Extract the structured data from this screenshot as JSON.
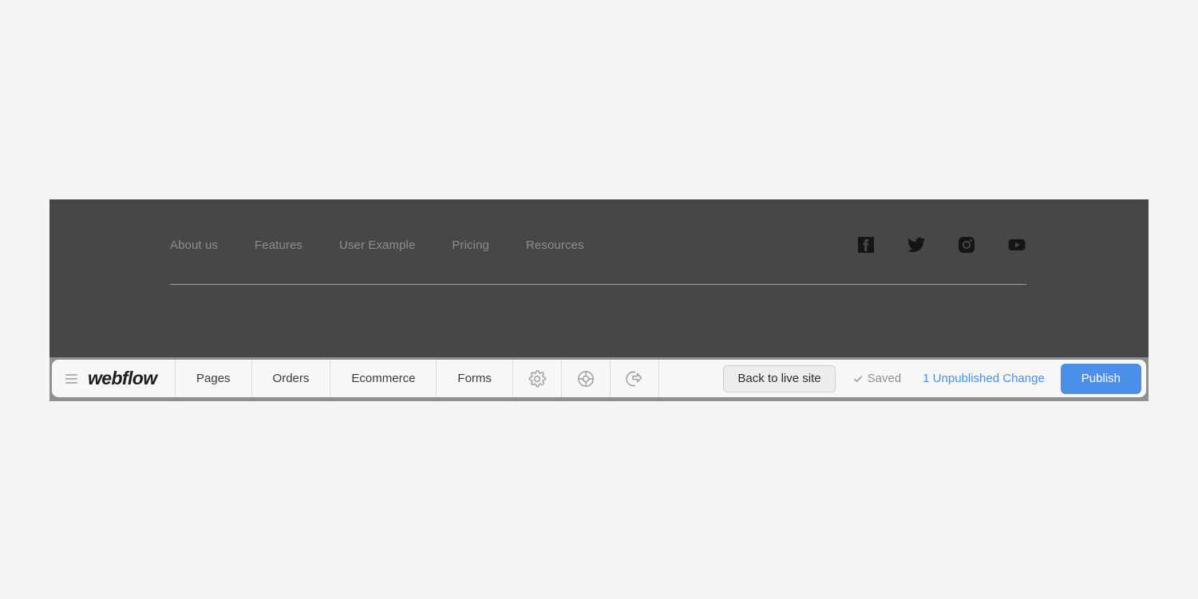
{
  "site_footer": {
    "nav_links": [
      {
        "label": "About us"
      },
      {
        "label": "Features"
      },
      {
        "label": "User Example"
      },
      {
        "label": "Pricing"
      },
      {
        "label": "Resources"
      }
    ],
    "social": [
      {
        "name": "facebook-icon"
      },
      {
        "name": "twitter-icon"
      },
      {
        "name": "instagram-icon"
      },
      {
        "name": "youtube-icon"
      }
    ],
    "background_color": "#474747",
    "link_color": "#8d8d8d",
    "divider_color": "#a0a0a0"
  },
  "toolbar": {
    "menu_icon": "hamburger-icon",
    "brand": "webflow",
    "tabs": [
      {
        "label": "Pages"
      },
      {
        "label": "Orders"
      },
      {
        "label": "Ecommerce"
      },
      {
        "label": "Forms"
      }
    ],
    "icon_buttons": [
      {
        "name": "settings-gear-icon"
      },
      {
        "name": "lifebuoy-help-icon"
      },
      {
        "name": "export-share-icon"
      }
    ],
    "back_to_live_site_label": "Back to live site",
    "saved_label": "Saved",
    "unpublished_changes_label": "1 Unpublished Change",
    "publish_label": "Publish",
    "accent_color": "#4a90e8",
    "link_color": "#4a8df0",
    "muted_text_color": "#8f8f8f",
    "background_color": "#f7f7f7",
    "frame_color": "#8f8f8f"
  },
  "page": {
    "background_color": "#f4f5f7"
  }
}
